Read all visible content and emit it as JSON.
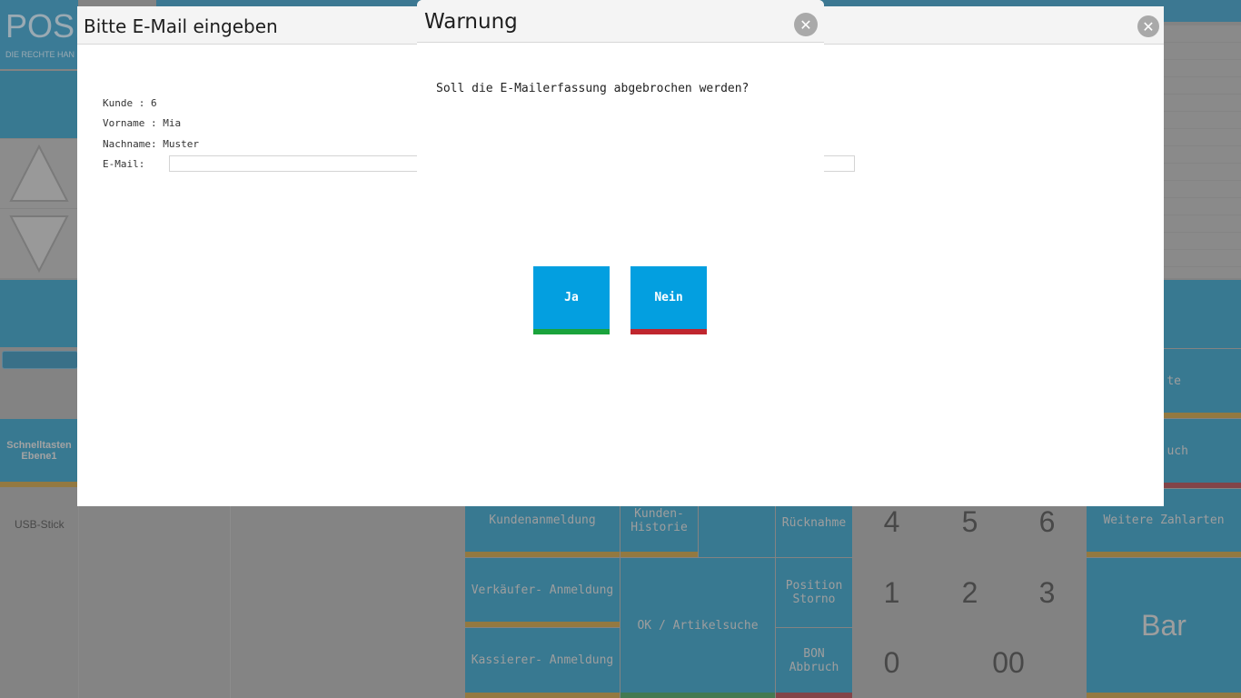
{
  "logo": {
    "text": "POSM",
    "subtitle": "DIE RECHTE HAN"
  },
  "sidebar": {
    "schnelltasten": "Schnelltasten Ebene1",
    "usb": "USB-Stick"
  },
  "pos_buttons": {
    "kundenanmeldung": "Kundenanmeldung",
    "kunden_historie": "Kunden- Historie",
    "ruecknahme": "Rücknahme",
    "verkaeufer": "Verkäufer- Anmeldung",
    "ok_artikelsuche": "OK / Artikelsuche",
    "position_storno": "Position Storno",
    "kassierer": "Kassierer- Anmeldung",
    "bon_abbruch": "BON Abbruch",
    "weitere_zahlarten": "Weitere Zahlarten",
    "bar": "Bar",
    "karte_partial": "te",
    "abbruch_partial": "uch"
  },
  "numpad": {
    "k4": "4",
    "k5": "5",
    "k6": "6",
    "k1": "1",
    "k2": "2",
    "k3": "3",
    "k0": "0",
    "k00": "00"
  },
  "email_dialog": {
    "title": "Bitte E-Mail eingeben",
    "kunde": "Kunde : 6",
    "vorname": "Vorname : Mia",
    "nachname": "Nachname: Muster",
    "email_label": "E-Mail:",
    "email_value": ""
  },
  "warn_dialog": {
    "title": "Warnung",
    "message": "Soll die E-Mailerfassung abgebrochen werden?",
    "yes": "Ja",
    "no": "Nein"
  },
  "colors": {
    "accent": "#039fe0",
    "yes_bar": "#1aa33c",
    "no_bar": "#c0262e",
    "pos_tile": "#057aa7"
  }
}
